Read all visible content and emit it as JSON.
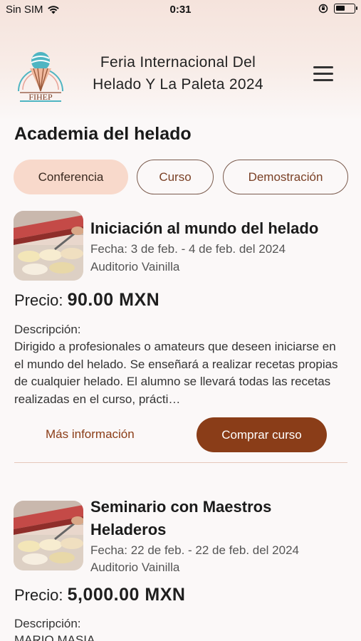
{
  "status_bar": {
    "carrier": "Sin SIM",
    "time": "0:31",
    "battery_level": 0.5
  },
  "header": {
    "logo_text": "FIHEP",
    "title_line1": "Feria Internacional Del",
    "title_line2": "Helado Y La Paleta 2024"
  },
  "section": {
    "title": "Academia del helado"
  },
  "tabs": [
    {
      "label": "Conferencia",
      "active": true
    },
    {
      "label": "Curso",
      "active": false
    },
    {
      "label": "Demostración",
      "active": false
    }
  ],
  "courses": [
    {
      "title": "Iniciación al mundo del helado",
      "date": "Fecha: 3 de feb. - 4 de feb. del 2024",
      "venue": "Auditorio Vainilla",
      "price_label": "Precio:",
      "price": "90.00 MXN",
      "description_label": "Descripción:",
      "description": "Dirigido a profesionales o amateurs que deseen iniciarse en el mundo del helado. Se enseñará a realizar recetas propias de cualquier helado. El alumno se llevará todas las recetas realizadas en el curso, prácti…",
      "more_label": "Más información",
      "buy_label": "Comprar curso"
    },
    {
      "title_line1": "Seminario con Maestros",
      "title_line2": "Heladeros",
      "date": "Fecha: 22 de feb. - 22 de feb. del 2024",
      "venue": "Auditorio Vainilla",
      "price_label": "Precio:",
      "price": "5,000.00 MXN",
      "description_label": "Descripción:",
      "description": "MARIO MASIA"
    }
  ],
  "colors": {
    "accent": "#8a3d18",
    "tab_active_bg": "#f8d9cb",
    "header_bg": "#f5e3dc"
  }
}
